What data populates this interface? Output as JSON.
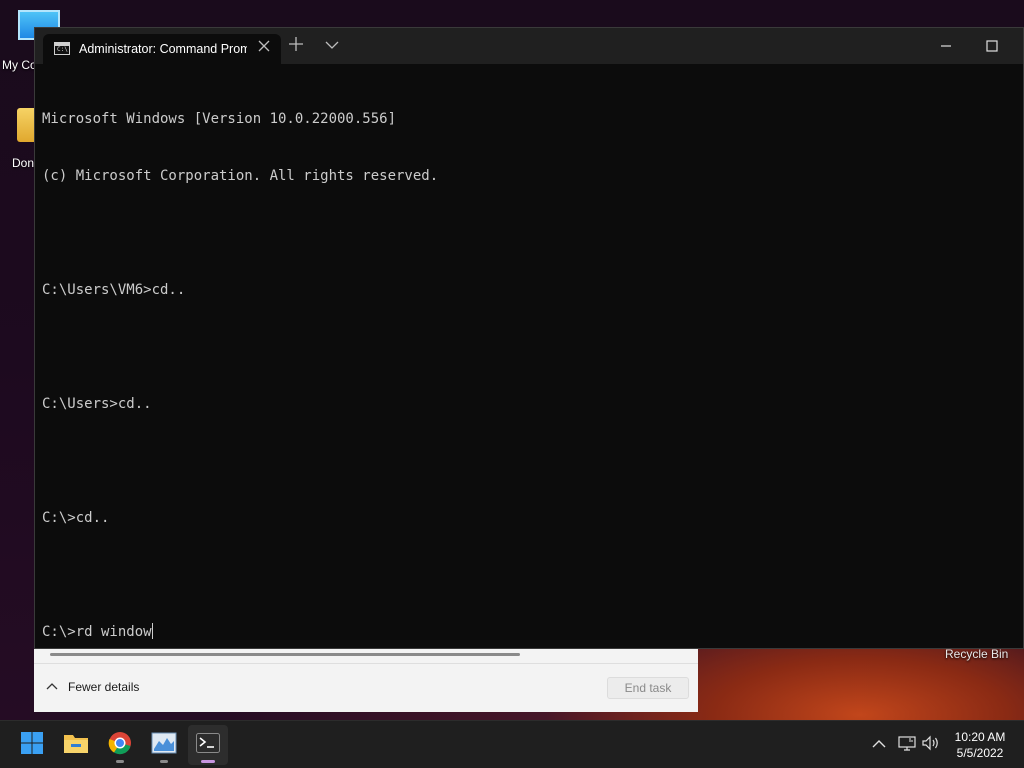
{
  "desktop": {
    "icons": [
      {
        "label": "My Co"
      },
      {
        "label": "Don"
      }
    ],
    "recycle_bin_label": "Recycle Bin"
  },
  "task_manager": {
    "fewer_details_label": "Fewer details",
    "end_task_label": "End task"
  },
  "terminal": {
    "tab_title": "Administrator: Command Promp",
    "lines": [
      "Microsoft Windows [Version 10.0.22000.556]",
      "(c) Microsoft Corporation. All rights reserved.",
      "",
      "C:\\Users\\VM6>cd..",
      "",
      "C:\\Users>cd..",
      "",
      "C:\\>cd..",
      "",
      "C:\\>rd window"
    ]
  },
  "taskbar": {
    "apps": [
      "windows-start-icon",
      "file-explorer-icon",
      "chrome-icon",
      "task-manager-icon",
      "terminal-icon"
    ],
    "clock": {
      "time": "10:20 AM",
      "date": "5/5/2022"
    }
  },
  "colors": {
    "console_bg": "#0c0c0c",
    "console_text": "#cccccc",
    "titlebar": "#202020",
    "taskbar": "#1f1f1f",
    "active_indicator": "#c896e0"
  }
}
